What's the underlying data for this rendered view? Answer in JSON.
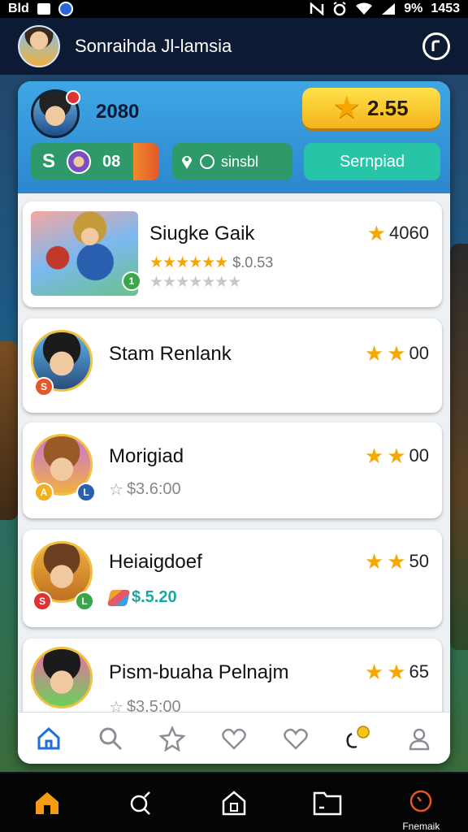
{
  "status_bar": {
    "left_text": "Bld",
    "right_percent": "9%",
    "right_time": "1453"
  },
  "header": {
    "title": "Sonraihda Jl-lamsia"
  },
  "profile": {
    "score": "2080",
    "coins": "2.55"
  },
  "pills": {
    "count": "08",
    "middle_label": "sinsbl",
    "right_label": "Sernpiad"
  },
  "items": [
    {
      "name": "Siugke Gaik",
      "score": "4060",
      "price": "$.0.53",
      "gold_stars": 6,
      "grey_stars": 7
    },
    {
      "name": "Stam Renlank",
      "score": "00"
    },
    {
      "name": "Morigiad",
      "score": "00",
      "price": "$3.6:00"
    },
    {
      "name": "Heiaigdoef",
      "score": "50",
      "price": "$.5.20"
    },
    {
      "name": "Pism-buaha Pelnajm",
      "score": "65",
      "price": "$3.5:00"
    }
  ],
  "bottom_nav": {
    "active_color": "#1e6fd9",
    "icons": [
      "home-icon",
      "search-icon",
      "star-icon",
      "heart-icon",
      "heart-outline-icon",
      "coin-chat-icon",
      "profile-icon"
    ]
  },
  "system_nav": {
    "last_label": "Fnemaik"
  },
  "colors": {
    "accent_green": "#2e9a6a",
    "accent_teal": "#27c4a7",
    "gold": "#f5a800",
    "header_bg": "#0d1a33",
    "home_orange": "#f39c12"
  }
}
